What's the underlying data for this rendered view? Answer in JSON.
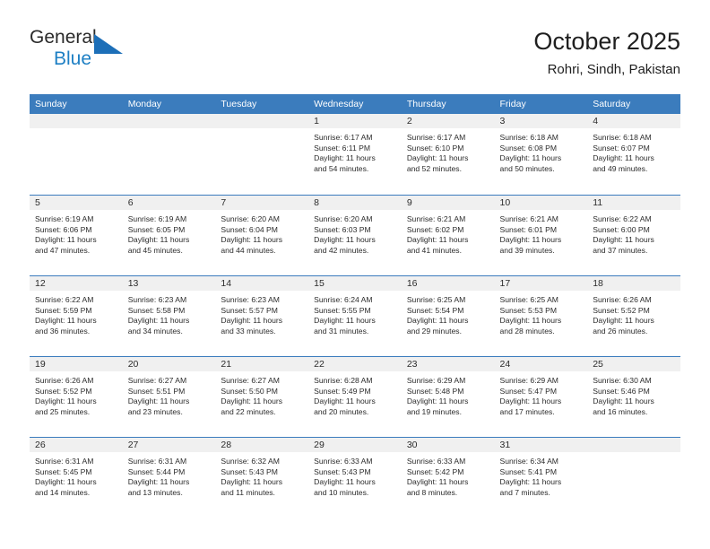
{
  "brand": {
    "word_general": "General",
    "word_blue": "Blue",
    "logo_icon": "blue-flag-triangle-icon",
    "accent_color": "#1d7fc4"
  },
  "header": {
    "title": "October 2025",
    "subtitle": "Rohri, Sindh, Pakistan"
  },
  "colors": {
    "header_blue": "#3b7cbd",
    "date_strip_gray": "#f0f0f0",
    "text": "#2b2b2b"
  },
  "weekday_headers": [
    "Sunday",
    "Monday",
    "Tuesday",
    "Wednesday",
    "Thursday",
    "Friday",
    "Saturday"
  ],
  "weeks": [
    [
      {
        "day": "",
        "sunrise": "",
        "sunset": "",
        "daylight_line1": "",
        "daylight_line2": ""
      },
      {
        "day": "",
        "sunrise": "",
        "sunset": "",
        "daylight_line1": "",
        "daylight_line2": ""
      },
      {
        "day": "",
        "sunrise": "",
        "sunset": "",
        "daylight_line1": "",
        "daylight_line2": ""
      },
      {
        "day": "1",
        "sunrise": "Sunrise: 6:17 AM",
        "sunset": "Sunset: 6:11 PM",
        "daylight_line1": "Daylight: 11 hours",
        "daylight_line2": "and 54 minutes."
      },
      {
        "day": "2",
        "sunrise": "Sunrise: 6:17 AM",
        "sunset": "Sunset: 6:10 PM",
        "daylight_line1": "Daylight: 11 hours",
        "daylight_line2": "and 52 minutes."
      },
      {
        "day": "3",
        "sunrise": "Sunrise: 6:18 AM",
        "sunset": "Sunset: 6:08 PM",
        "daylight_line1": "Daylight: 11 hours",
        "daylight_line2": "and 50 minutes."
      },
      {
        "day": "4",
        "sunrise": "Sunrise: 6:18 AM",
        "sunset": "Sunset: 6:07 PM",
        "daylight_line1": "Daylight: 11 hours",
        "daylight_line2": "and 49 minutes."
      }
    ],
    [
      {
        "day": "5",
        "sunrise": "Sunrise: 6:19 AM",
        "sunset": "Sunset: 6:06 PM",
        "daylight_line1": "Daylight: 11 hours",
        "daylight_line2": "and 47 minutes."
      },
      {
        "day": "6",
        "sunrise": "Sunrise: 6:19 AM",
        "sunset": "Sunset: 6:05 PM",
        "daylight_line1": "Daylight: 11 hours",
        "daylight_line2": "and 45 minutes."
      },
      {
        "day": "7",
        "sunrise": "Sunrise: 6:20 AM",
        "sunset": "Sunset: 6:04 PM",
        "daylight_line1": "Daylight: 11 hours",
        "daylight_line2": "and 44 minutes."
      },
      {
        "day": "8",
        "sunrise": "Sunrise: 6:20 AM",
        "sunset": "Sunset: 6:03 PM",
        "daylight_line1": "Daylight: 11 hours",
        "daylight_line2": "and 42 minutes."
      },
      {
        "day": "9",
        "sunrise": "Sunrise: 6:21 AM",
        "sunset": "Sunset: 6:02 PM",
        "daylight_line1": "Daylight: 11 hours",
        "daylight_line2": "and 41 minutes."
      },
      {
        "day": "10",
        "sunrise": "Sunrise: 6:21 AM",
        "sunset": "Sunset: 6:01 PM",
        "daylight_line1": "Daylight: 11 hours",
        "daylight_line2": "and 39 minutes."
      },
      {
        "day": "11",
        "sunrise": "Sunrise: 6:22 AM",
        "sunset": "Sunset: 6:00 PM",
        "daylight_line1": "Daylight: 11 hours",
        "daylight_line2": "and 37 minutes."
      }
    ],
    [
      {
        "day": "12",
        "sunrise": "Sunrise: 6:22 AM",
        "sunset": "Sunset: 5:59 PM",
        "daylight_line1": "Daylight: 11 hours",
        "daylight_line2": "and 36 minutes."
      },
      {
        "day": "13",
        "sunrise": "Sunrise: 6:23 AM",
        "sunset": "Sunset: 5:58 PM",
        "daylight_line1": "Daylight: 11 hours",
        "daylight_line2": "and 34 minutes."
      },
      {
        "day": "14",
        "sunrise": "Sunrise: 6:23 AM",
        "sunset": "Sunset: 5:57 PM",
        "daylight_line1": "Daylight: 11 hours",
        "daylight_line2": "and 33 minutes."
      },
      {
        "day": "15",
        "sunrise": "Sunrise: 6:24 AM",
        "sunset": "Sunset: 5:55 PM",
        "daylight_line1": "Daylight: 11 hours",
        "daylight_line2": "and 31 minutes."
      },
      {
        "day": "16",
        "sunrise": "Sunrise: 6:25 AM",
        "sunset": "Sunset: 5:54 PM",
        "daylight_line1": "Daylight: 11 hours",
        "daylight_line2": "and 29 minutes."
      },
      {
        "day": "17",
        "sunrise": "Sunrise: 6:25 AM",
        "sunset": "Sunset: 5:53 PM",
        "daylight_line1": "Daylight: 11 hours",
        "daylight_line2": "and 28 minutes."
      },
      {
        "day": "18",
        "sunrise": "Sunrise: 6:26 AM",
        "sunset": "Sunset: 5:52 PM",
        "daylight_line1": "Daylight: 11 hours",
        "daylight_line2": "and 26 minutes."
      }
    ],
    [
      {
        "day": "19",
        "sunrise": "Sunrise: 6:26 AM",
        "sunset": "Sunset: 5:52 PM",
        "daylight_line1": "Daylight: 11 hours",
        "daylight_line2": "and 25 minutes."
      },
      {
        "day": "20",
        "sunrise": "Sunrise: 6:27 AM",
        "sunset": "Sunset: 5:51 PM",
        "daylight_line1": "Daylight: 11 hours",
        "daylight_line2": "and 23 minutes."
      },
      {
        "day": "21",
        "sunrise": "Sunrise: 6:27 AM",
        "sunset": "Sunset: 5:50 PM",
        "daylight_line1": "Daylight: 11 hours",
        "daylight_line2": "and 22 minutes."
      },
      {
        "day": "22",
        "sunrise": "Sunrise: 6:28 AM",
        "sunset": "Sunset: 5:49 PM",
        "daylight_line1": "Daylight: 11 hours",
        "daylight_line2": "and 20 minutes."
      },
      {
        "day": "23",
        "sunrise": "Sunrise: 6:29 AM",
        "sunset": "Sunset: 5:48 PM",
        "daylight_line1": "Daylight: 11 hours",
        "daylight_line2": "and 19 minutes."
      },
      {
        "day": "24",
        "sunrise": "Sunrise: 6:29 AM",
        "sunset": "Sunset: 5:47 PM",
        "daylight_line1": "Daylight: 11 hours",
        "daylight_line2": "and 17 minutes."
      },
      {
        "day": "25",
        "sunrise": "Sunrise: 6:30 AM",
        "sunset": "Sunset: 5:46 PM",
        "daylight_line1": "Daylight: 11 hours",
        "daylight_line2": "and 16 minutes."
      }
    ],
    [
      {
        "day": "26",
        "sunrise": "Sunrise: 6:31 AM",
        "sunset": "Sunset: 5:45 PM",
        "daylight_line1": "Daylight: 11 hours",
        "daylight_line2": "and 14 minutes."
      },
      {
        "day": "27",
        "sunrise": "Sunrise: 6:31 AM",
        "sunset": "Sunset: 5:44 PM",
        "daylight_line1": "Daylight: 11 hours",
        "daylight_line2": "and 13 minutes."
      },
      {
        "day": "28",
        "sunrise": "Sunrise: 6:32 AM",
        "sunset": "Sunset: 5:43 PM",
        "daylight_line1": "Daylight: 11 hours",
        "daylight_line2": "and 11 minutes."
      },
      {
        "day": "29",
        "sunrise": "Sunrise: 6:33 AM",
        "sunset": "Sunset: 5:43 PM",
        "daylight_line1": "Daylight: 11 hours",
        "daylight_line2": "and 10 minutes."
      },
      {
        "day": "30",
        "sunrise": "Sunrise: 6:33 AM",
        "sunset": "Sunset: 5:42 PM",
        "daylight_line1": "Daylight: 11 hours",
        "daylight_line2": "and 8 minutes."
      },
      {
        "day": "31",
        "sunrise": "Sunrise: 6:34 AM",
        "sunset": "Sunset: 5:41 PM",
        "daylight_line1": "Daylight: 11 hours",
        "daylight_line2": "and 7 minutes."
      },
      {
        "day": "",
        "sunrise": "",
        "sunset": "",
        "daylight_line1": "",
        "daylight_line2": ""
      }
    ]
  ]
}
